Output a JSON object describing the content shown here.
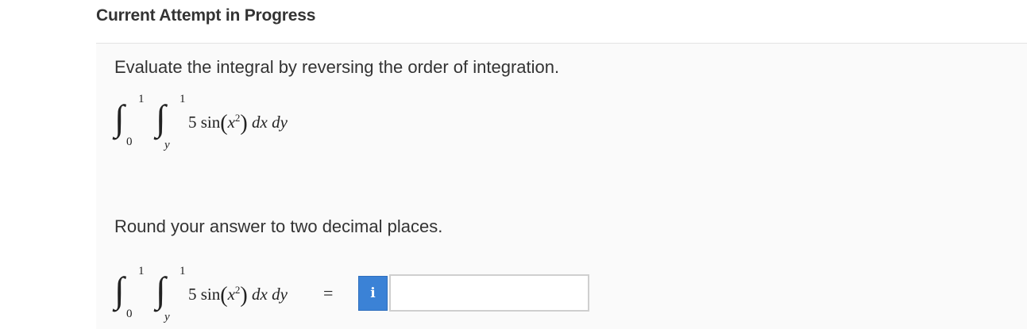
{
  "header": {
    "title": "Current Attempt in Progress"
  },
  "question": {
    "prompt": "Evaluate the integral by reversing the order of integration.",
    "integral": {
      "outer_upper": "1",
      "outer_lower": "0",
      "inner_upper": "1",
      "inner_lower": "y",
      "coefficient": "5",
      "function": "sin",
      "variable": "x",
      "exponent": "2",
      "differentials": "dx dy"
    },
    "instruction": "Round your answer to two decimal places.",
    "equals_sign": "=",
    "info_button_label": "i",
    "answer": {
      "value": "",
      "placeholder": ""
    }
  },
  "colors": {
    "info_button": "#3b82d6",
    "panel_background": "#fafafa"
  }
}
